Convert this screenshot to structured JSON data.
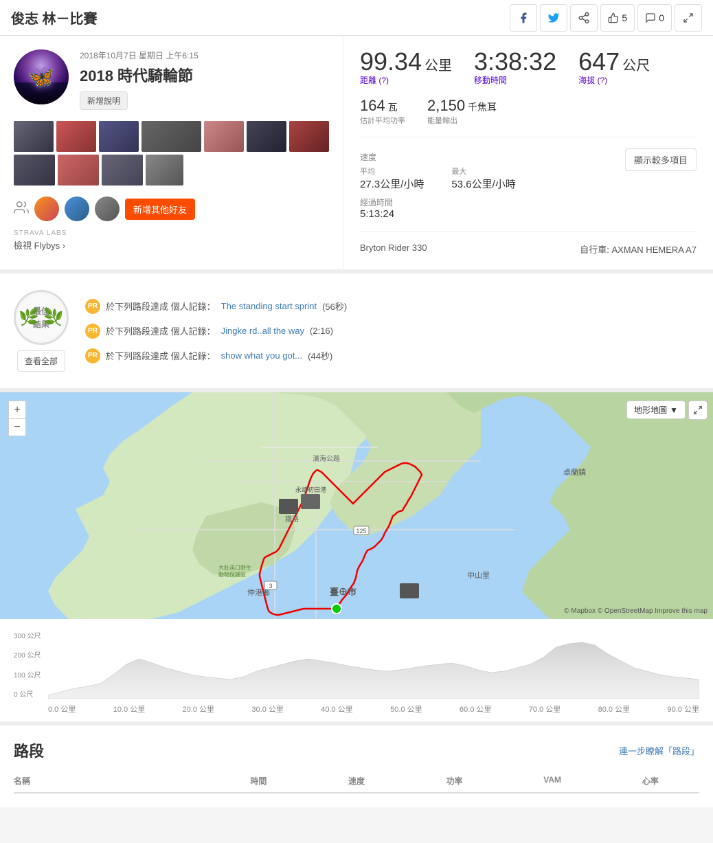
{
  "header": {
    "title": "俊志 林－比賽",
    "likes_count": "5",
    "comments_count": "0"
  },
  "activity": {
    "date": "2018年10月7日 星期日 上午6:15",
    "name": "2018 時代騎輪節",
    "add_desc_label": "新增說明"
  },
  "stats": {
    "distance_value": "99.34",
    "distance_unit": "公里",
    "distance_label": "距離",
    "time_value": "3:38:32",
    "time_label": "移動時間",
    "elevation_value": "647",
    "elevation_unit": "公尺",
    "elevation_label": "海拔",
    "elevation_link_label": "海拔 (?)",
    "distance_link_label": "距離 (?)",
    "power_value": "164",
    "power_unit": "瓦",
    "power_label": "估計平均功率",
    "calories_value": "2,150",
    "calories_unit": "千焦耳",
    "calories_label": "能量輸出",
    "show_more_label": "顯示較多項目",
    "speed_label": "速度",
    "speed_avg": "27.3公里/小時",
    "speed_max": "53.6公里/小時",
    "avg_label": "平均",
    "max_label": "最大",
    "moving_time_label": "經過時間",
    "moving_time_val": "5:13:24",
    "device_label": "Bryton Rider 330",
    "bike_label": "自行車: AXMAN HEMERA A7"
  },
  "pr_section": {
    "title_line1": "最佳",
    "title_line2": "結果",
    "view_all_label": "查看全部",
    "items": [
      {
        "prefix": "於下列路段達成 個人記錄：",
        "segment_name": "The standing start sprint",
        "time": "(56秒)"
      },
      {
        "prefix": "於下列路段達成 個人記錄：",
        "segment_name": "Jingke rd..all the way",
        "time": "(2:16)"
      },
      {
        "prefix": "於下列路段達成 個人記錄：",
        "segment_name": "show what you got...",
        "time": "(44秒)"
      }
    ]
  },
  "map": {
    "type_label": "地形地圖",
    "attribution": "© Mapbox © OpenStreetMap Improve this map",
    "zoom_in": "+",
    "zoom_out": "−"
  },
  "elevation": {
    "y_labels": [
      "300 公尺",
      "200 公尺",
      "100 公尺",
      "0 公尺"
    ],
    "x_labels": [
      "0.0 公里",
      "10.0 公里",
      "20.0 公里",
      "30.0 公里",
      "40.0 公里",
      "50.0 公里",
      "60.0 公里",
      "70.0 公里",
      "80.0 公里",
      "90.0 公里"
    ]
  },
  "segments": {
    "title": "路段",
    "link_label": "連一步瞭解「路段」",
    "columns": [
      "名稱",
      "時間",
      "速度",
      "功率",
      "VAM",
      "心率"
    ]
  },
  "friends": {
    "add_label": "新增其他好友"
  },
  "strava_labs": {
    "label": "STRAVA LABS",
    "flybys_label": "檢視 Flybys ›"
  }
}
